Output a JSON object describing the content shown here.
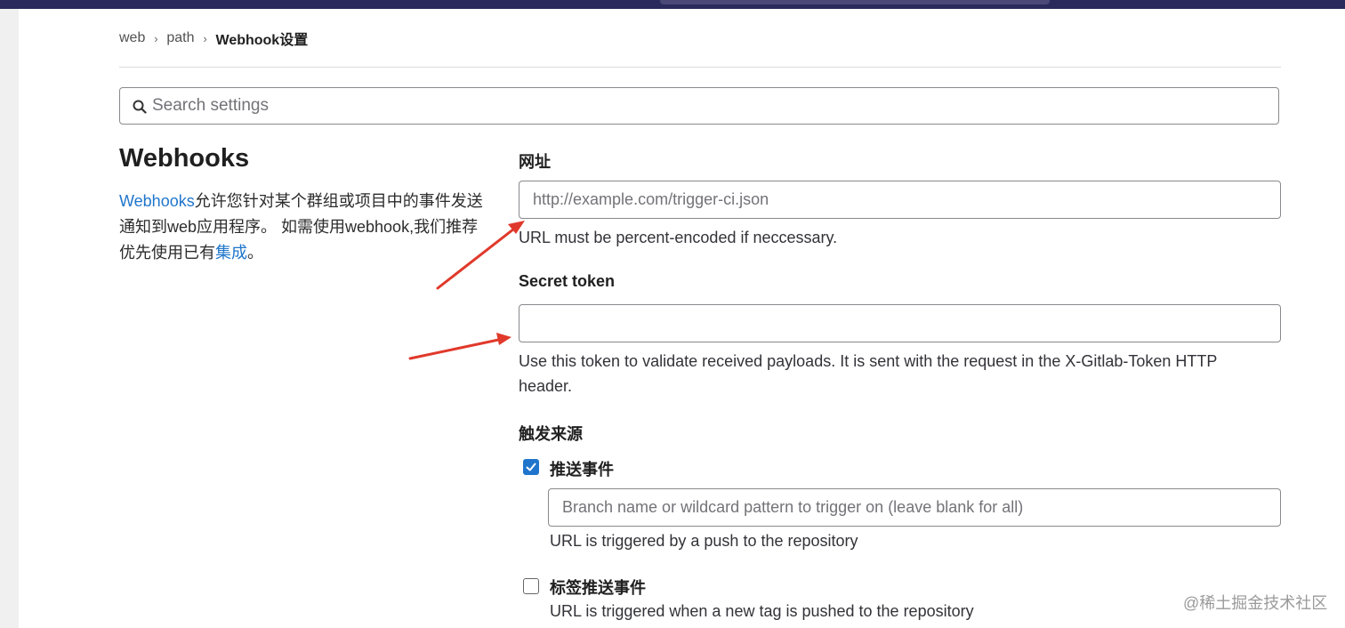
{
  "breadcrumb": {
    "items": [
      "web",
      "path"
    ],
    "current": "Webhook设置"
  },
  "search": {
    "placeholder": "Search settings",
    "value": ""
  },
  "section": {
    "title": "Webhooks",
    "desc_link": "Webhooks",
    "desc_text1": "允许您针对某个群组或项目中的事件发送通知到web应用程序。 如需使用webhook,我们推荐优先使用已有",
    "desc_link2": "集成",
    "desc_text2": "。"
  },
  "url_field": {
    "label": "网址",
    "placeholder": "http://example.com/trigger-ci.json",
    "value": "",
    "help": "URL must be percent-encoded if neccessary."
  },
  "token_field": {
    "label": "Secret token",
    "value": "",
    "help": "Use this token to validate received payloads. It is sent with the request in the X-Gitlab-Token HTTP header."
  },
  "triggers": {
    "heading": "触发来源",
    "push_events": {
      "label": "推送事件",
      "checked": true,
      "branch_placeholder": "Branch name or wildcard pattern to trigger on (leave blank for all)",
      "branch_value": "",
      "help": "URL is triggered by a push to the repository"
    },
    "tag_push_events": {
      "label": "标签推送事件",
      "checked": false,
      "help": "URL is triggered when a new tag is pushed to the repository"
    }
  },
  "watermark": "@稀土掘金技术社区",
  "colors": {
    "accent": "#1f75cb",
    "topbar": "#2b2a5c",
    "annotation_arrow": "#e0392b"
  }
}
